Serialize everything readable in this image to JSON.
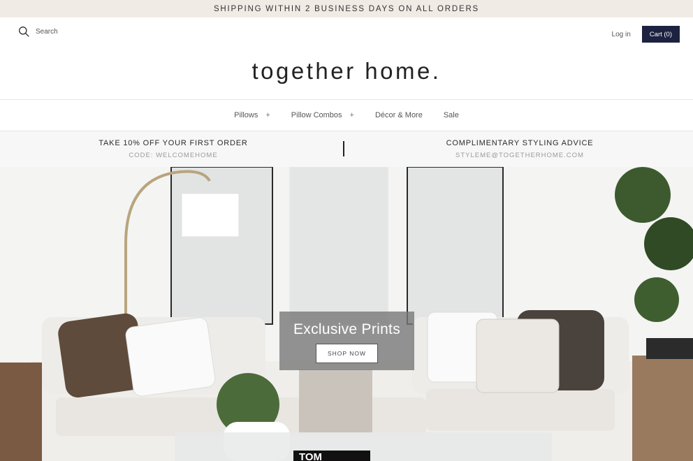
{
  "announcement": "SHIPPING WITHIN 2 BUSINESS DAYS ON ALL ORDERS",
  "header": {
    "search_label": "Search",
    "login_label": "Log in",
    "cart_label": "Cart (0)",
    "logo": "together home."
  },
  "nav": {
    "items": [
      {
        "label": "Pillows",
        "expand": "+"
      },
      {
        "label": "Pillow Combos",
        "expand": "+"
      },
      {
        "label": "Décor & More"
      },
      {
        "label": "Sale"
      }
    ]
  },
  "promo": {
    "left_title": "TAKE 10% OFF YOUR FIRST ORDER",
    "left_sub": "CODE: WELCOMEHOME",
    "right_title": "COMPLIMENTARY STYLING ADVICE",
    "right_sub": "STYLEME@TOGETHERHOME.COM"
  },
  "hero": {
    "title": "Exclusive Prints",
    "button_label": "SHOP NOW",
    "book_text": "TOM"
  },
  "colors": {
    "announcement_bg": "#f1ebe6",
    "cart_bg": "#1c2240",
    "promo_bg": "#f7f7f7"
  }
}
